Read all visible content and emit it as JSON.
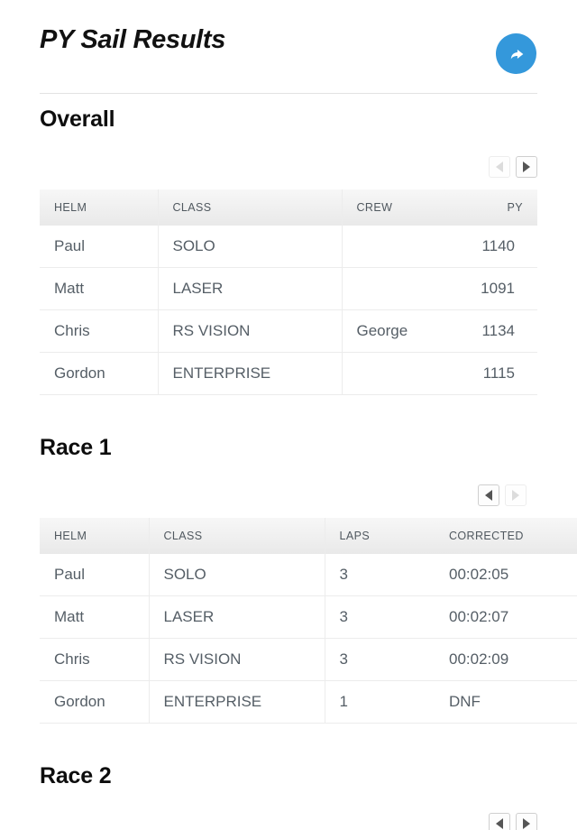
{
  "header": {
    "title": "PY Sail Results",
    "share_icon": "share-arrow-icon",
    "share_color": "#3498db"
  },
  "sections": [
    {
      "id": "overall",
      "title": "Overall",
      "pager": {
        "prev_label": "◀",
        "next_label": "▶",
        "prev_enabled": false,
        "next_enabled": true
      },
      "columns": [
        "HELM",
        "CLASS",
        "CREW",
        "PY"
      ],
      "rows": [
        {
          "helm": "Paul",
          "class": "SOLO",
          "crew": "",
          "py": "1140"
        },
        {
          "helm": "Matt",
          "class": "LASER",
          "crew": "",
          "py": "1091"
        },
        {
          "helm": "Chris",
          "class": "RS VISION",
          "crew": "George",
          "py": "1134"
        },
        {
          "helm": "Gordon",
          "class": "ENTERPRISE",
          "crew": "",
          "py": "1115"
        }
      ]
    },
    {
      "id": "race1",
      "title": "Race 1",
      "pager": {
        "prev_label": "◀",
        "next_label": "▶",
        "prev_enabled": true,
        "next_enabled": false
      },
      "columns": [
        "HELM",
        "CLASS",
        "LAPS",
        "CORRECTED"
      ],
      "rows": [
        {
          "helm": "Paul",
          "class": "SOLO",
          "laps": "3",
          "corrected": "00:02:05"
        },
        {
          "helm": "Matt",
          "class": "LASER",
          "laps": "3",
          "corrected": "00:02:07"
        },
        {
          "helm": "Chris",
          "class": "RS VISION",
          "laps": "3",
          "corrected": "00:02:09"
        },
        {
          "helm": "Gordon",
          "class": "ENTERPRISE",
          "laps": "1",
          "corrected": "DNF"
        }
      ]
    },
    {
      "id": "race2",
      "title": "Race 2",
      "pager": {
        "prev_label": "◀",
        "next_label": "▶",
        "prev_enabled": true,
        "next_enabled": true
      },
      "columns": [],
      "rows": []
    }
  ]
}
